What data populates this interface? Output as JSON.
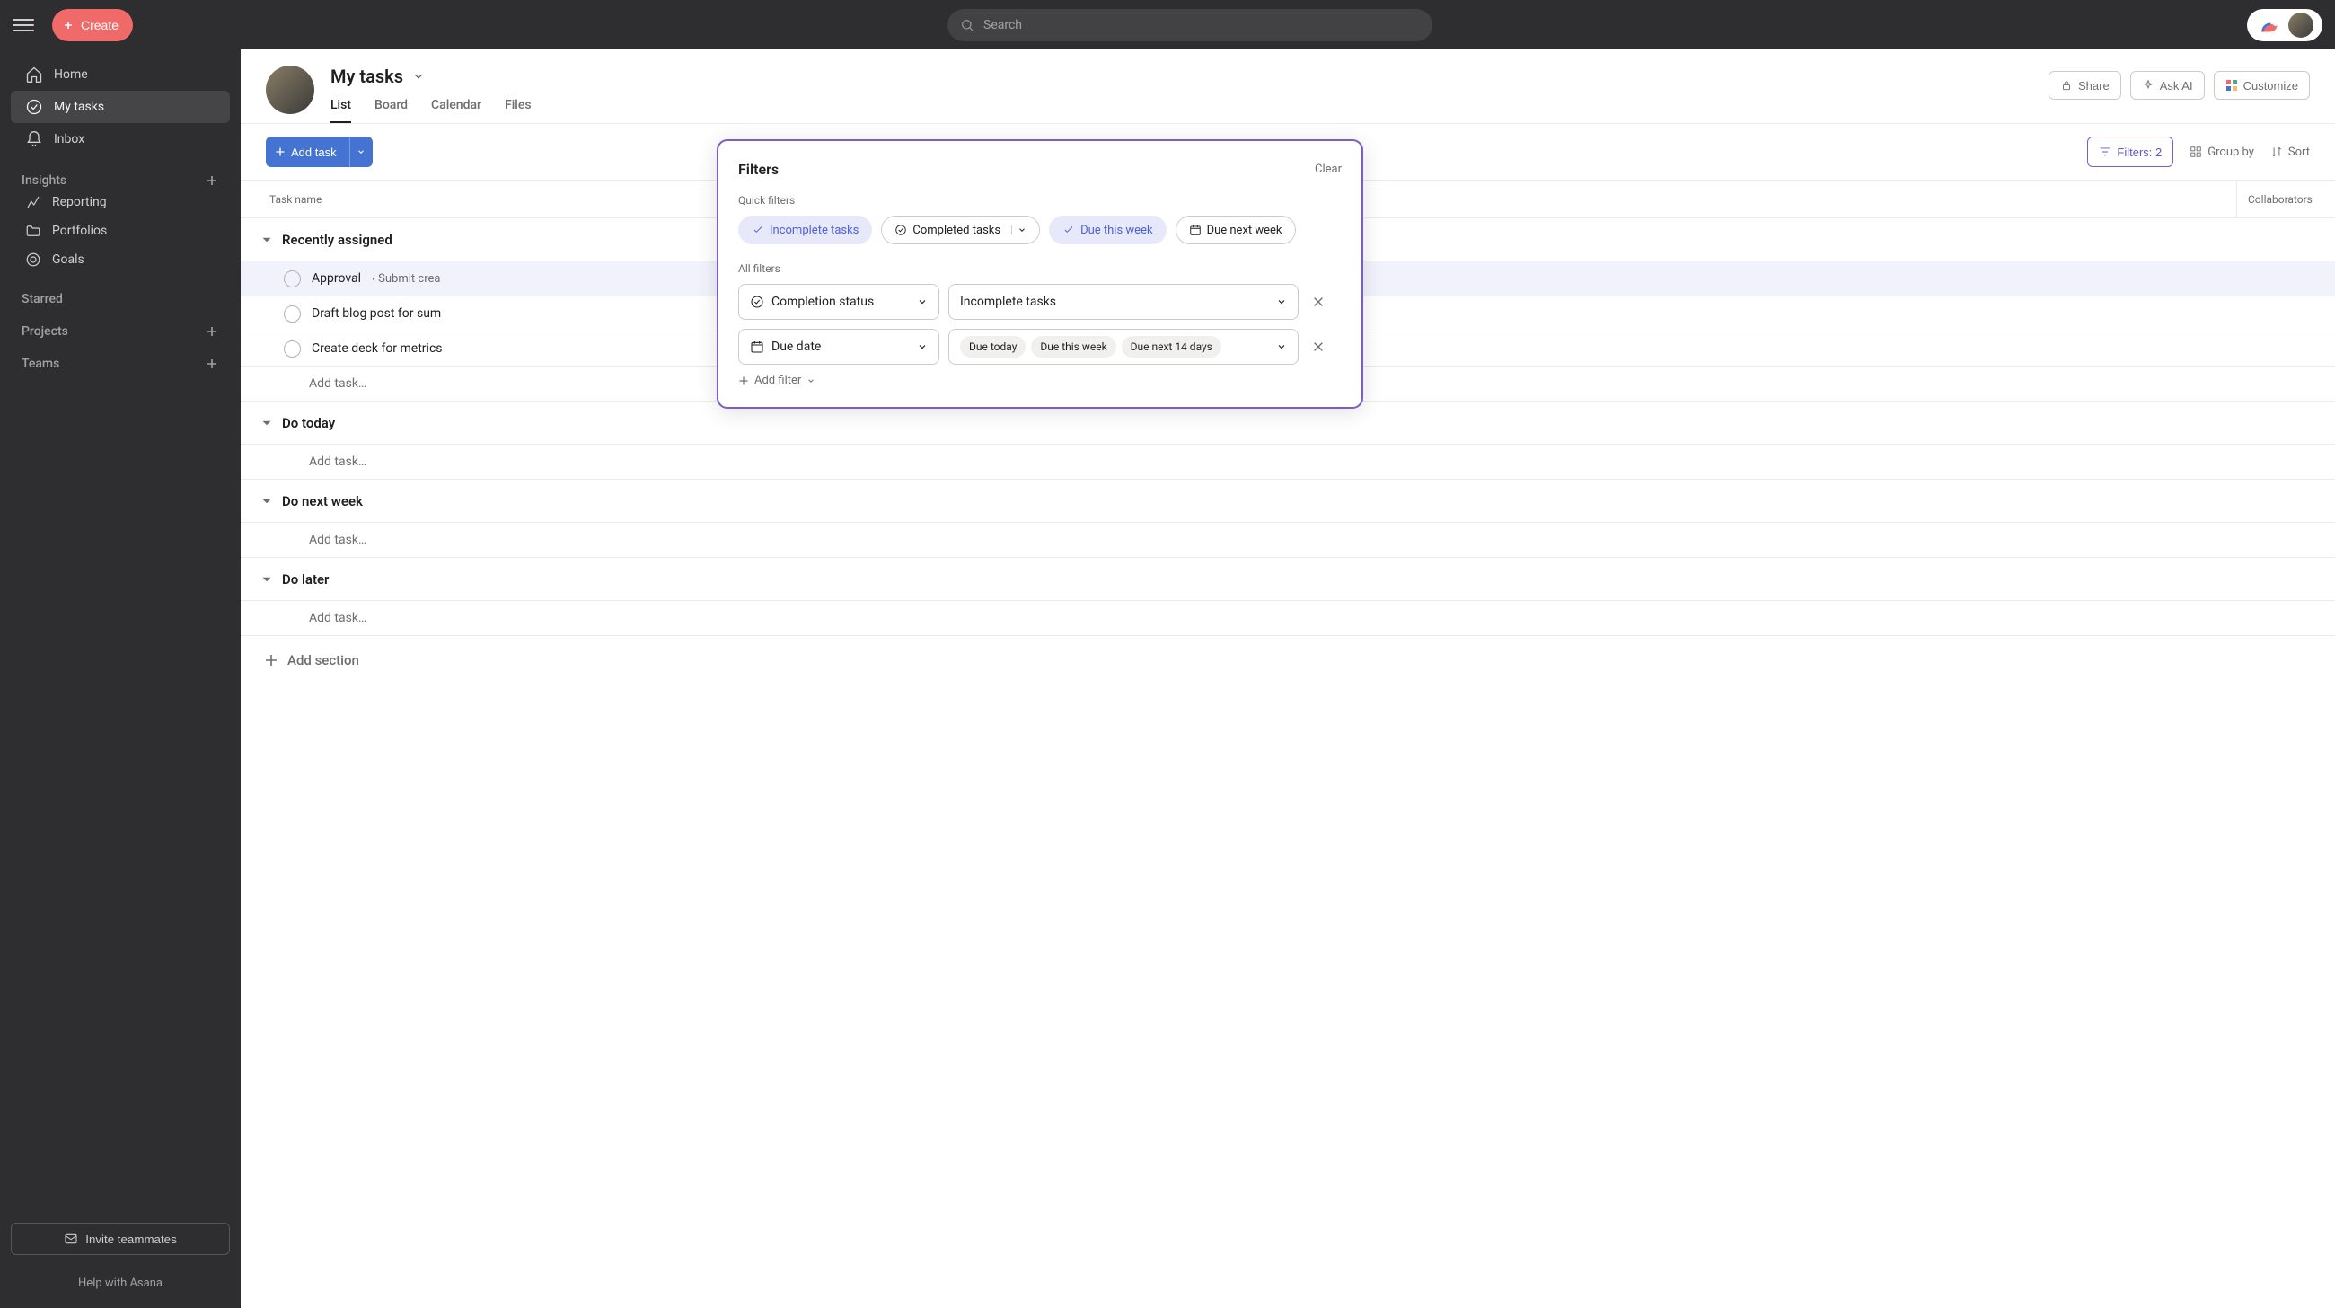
{
  "topbar": {
    "create": "Create",
    "search_placeholder": "Search"
  },
  "sidebar": {
    "nav": {
      "home": "Home",
      "my_tasks": "My tasks",
      "inbox": "Inbox"
    },
    "insights": {
      "label": "Insights",
      "reporting": "Reporting",
      "portfolios": "Portfolios",
      "goals": "Goals"
    },
    "starred": "Starred",
    "projects": "Projects",
    "teams": "Teams",
    "invite": "Invite teammates",
    "help": "Help with Asana"
  },
  "header": {
    "title": "My tasks",
    "tabs": {
      "list": "List",
      "board": "Board",
      "calendar": "Calendar",
      "files": "Files"
    },
    "share": "Share",
    "ask_ai": "Ask AI",
    "customize": "Customize"
  },
  "toolbar": {
    "add_task": "Add task",
    "filters": "Filters: 2",
    "group_by": "Group by",
    "sort": "Sort"
  },
  "columns": {
    "name": "Task name",
    "collab": "Collaborators"
  },
  "sections": {
    "recently": {
      "title": "Recently assigned",
      "tasks": [
        {
          "name": "Approval",
          "sub": "‹  Submit crea"
        },
        {
          "name": "Draft blog post for sum"
        },
        {
          "name": "Create deck for metrics "
        }
      ],
      "add": "Add task…"
    },
    "today": {
      "title": "Do today",
      "add": "Add task…"
    },
    "next_week": {
      "title": "Do next week",
      "add": "Add task…"
    },
    "later": {
      "title": "Do later",
      "add": "Add task…"
    }
  },
  "add_section": "Add section",
  "popover": {
    "title": "Filters",
    "clear": "Clear",
    "quick_label": "Quick filters",
    "quick": {
      "incomplete": "Incomplete tasks",
      "completed": "Completed tasks",
      "due_this_week": "Due this week",
      "due_next_week": "Due next week"
    },
    "all_label": "All filters",
    "filters": [
      {
        "field": "Completion status",
        "value": "Incomplete tasks"
      },
      {
        "field": "Due date",
        "values": [
          "Due today",
          "Due this week",
          "Due next 14 days"
        ]
      }
    ],
    "add_filter": "Add filter"
  }
}
